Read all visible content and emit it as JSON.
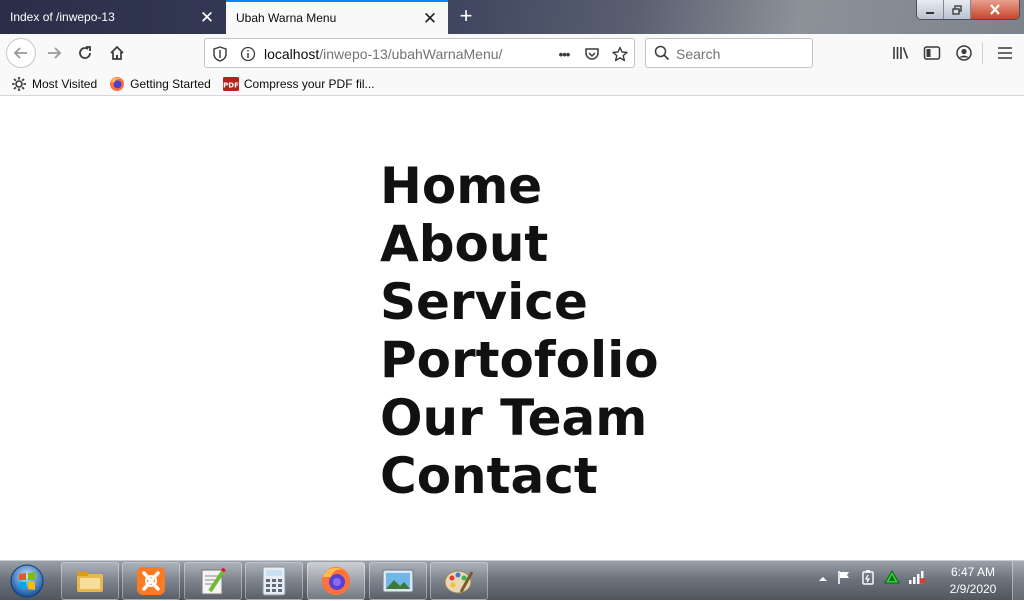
{
  "window": {
    "tabs": [
      {
        "title": "Index of /inwepo-13",
        "active": false
      },
      {
        "title": "Ubah Warna Menu",
        "active": true
      }
    ]
  },
  "navbar": {
    "url_host": "localhost",
    "url_path": "/inwepo-13/ubahWarnaMenu/",
    "page_actions_label": "•••",
    "search_placeholder": "Search"
  },
  "bookmarks": [
    {
      "label": "Most Visited",
      "icon": "gear-icon"
    },
    {
      "label": "Getting Started",
      "icon": "firefox-icon"
    },
    {
      "label": "Compress your PDF fil...",
      "icon": "pdf-icon"
    }
  ],
  "pdf_badge": "PDF",
  "page": {
    "menu": [
      "Home",
      "About",
      "Service",
      "Portofolio",
      "Our Team",
      "Contact"
    ]
  },
  "taskbar": {
    "apps": [
      "file-explorer-icon",
      "xampp-icon",
      "notepadpp-icon",
      "calculator-icon",
      "firefox-icon",
      "image-viewer-icon",
      "paint-icon"
    ],
    "clock_time": "6:47 AM",
    "clock_date": "2/9/2020"
  },
  "colors": {
    "accent": "#0a84ff",
    "menu_text": "#111111"
  }
}
